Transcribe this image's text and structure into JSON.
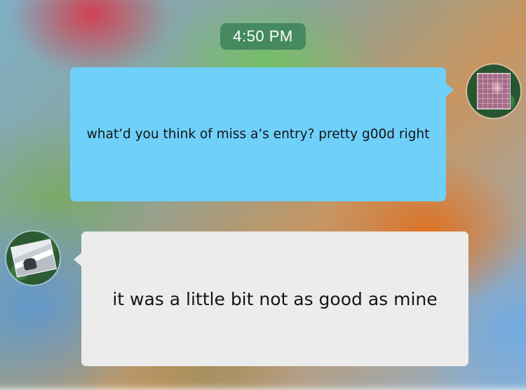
{
  "header": {
    "timestamp": "4:50 PM"
  },
  "messages": [
    {
      "sender": "self",
      "text": "what’d you think of miss a’s entry? pretty g00d right",
      "bubble_color": "#6fd0fa"
    },
    {
      "sender": "other",
      "text": "it was a little bit not as good as mine",
      "bubble_color": "#ececec"
    }
  ],
  "avatars": {
    "self": "avatar-self",
    "other": "avatar-other"
  }
}
